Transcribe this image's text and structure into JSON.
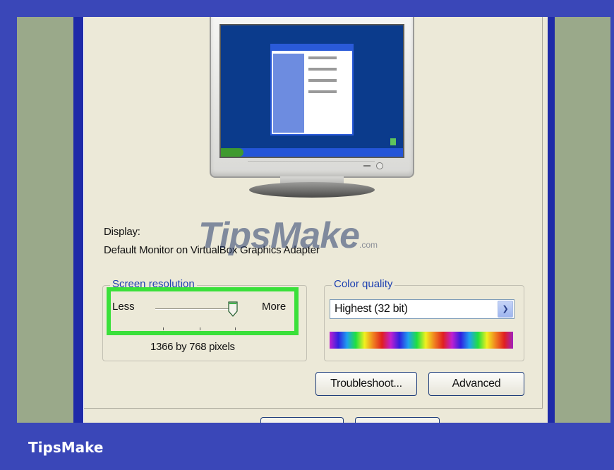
{
  "display": {
    "label": "Display:",
    "value": "Default Monitor on VirtualBox Graphics Adapter"
  },
  "screen_resolution": {
    "title": "Screen resolution",
    "less_label": "Less",
    "more_label": "More",
    "caption": "1366 by 768 pixels"
  },
  "color_quality": {
    "title": "Color quality",
    "selected": "Highest (32 bit)"
  },
  "buttons": {
    "troubleshoot": "Troubleshoot...",
    "advanced": "Advanced"
  },
  "watermark": {
    "text": "TipsMake",
    "suffix": ".com"
  },
  "footer": {
    "brand": "TipsMake"
  },
  "colors": {
    "frame_blue": "#3a47b8",
    "dialog_bg": "#ece9d8",
    "highlight_green": "#3ae03a",
    "group_title_blue": "#1c3fb0"
  },
  "icons": [
    "monitor-preview-icon",
    "chevron-down-icon"
  ]
}
